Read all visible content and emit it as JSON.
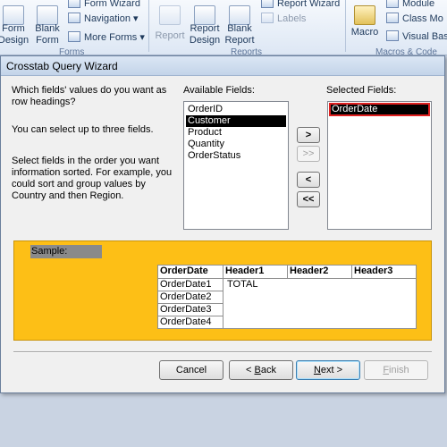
{
  "ribbon": {
    "form_design": "Form\nDesign",
    "blank_form": "Blank\nForm",
    "form_wizard": "Form Wizard",
    "navigation": "Navigation",
    "more_forms": "More Forms",
    "forms_group": "Forms",
    "report": "Report",
    "report_design": "Report\nDesign",
    "blank_report": "Blank\nReport",
    "report_wizard": "Report Wizard",
    "labels": "Labels",
    "reports_group": "Reports",
    "macro": "Macro",
    "module": "Module",
    "class_module": "Class Mo",
    "visual_basic": "Visual Basi",
    "macros_group": "Macros & Code"
  },
  "dialog": {
    "title": "Crosstab Query Wizard",
    "question": "Which fields' values do you want as row headings?",
    "limit_note": "You can select up to three fields.",
    "order_note": "Select fields in the order you want information sorted.  For example, you could sort and group values by Country and then Region.",
    "available_label": "Available Fields:",
    "selected_label": "Selected Fields:",
    "available_fields": [
      "OrderID",
      "Customer",
      "Product",
      "Quantity",
      "OrderStatus"
    ],
    "available_selected_index": 1,
    "selected_fields": [
      "OrderDate"
    ],
    "move_buttons": {
      "add": ">",
      "add_all": ">>",
      "remove": "<",
      "remove_all": "<<"
    },
    "sample": {
      "label": "Sample:",
      "corner": "OrderDate",
      "headers": [
        "Header1",
        "Header2",
        "Header3"
      ],
      "rows": [
        "OrderDate1",
        "OrderDate2",
        "OrderDate3",
        "OrderDate4"
      ],
      "total": "TOTAL"
    },
    "buttons": {
      "cancel": "Cancel",
      "back_u": "B",
      "back_rest": "ack",
      "back_prefix": "< ",
      "next_u": "N",
      "next_rest": "ext >",
      "finish_u": "F",
      "finish_rest": "inish"
    }
  }
}
